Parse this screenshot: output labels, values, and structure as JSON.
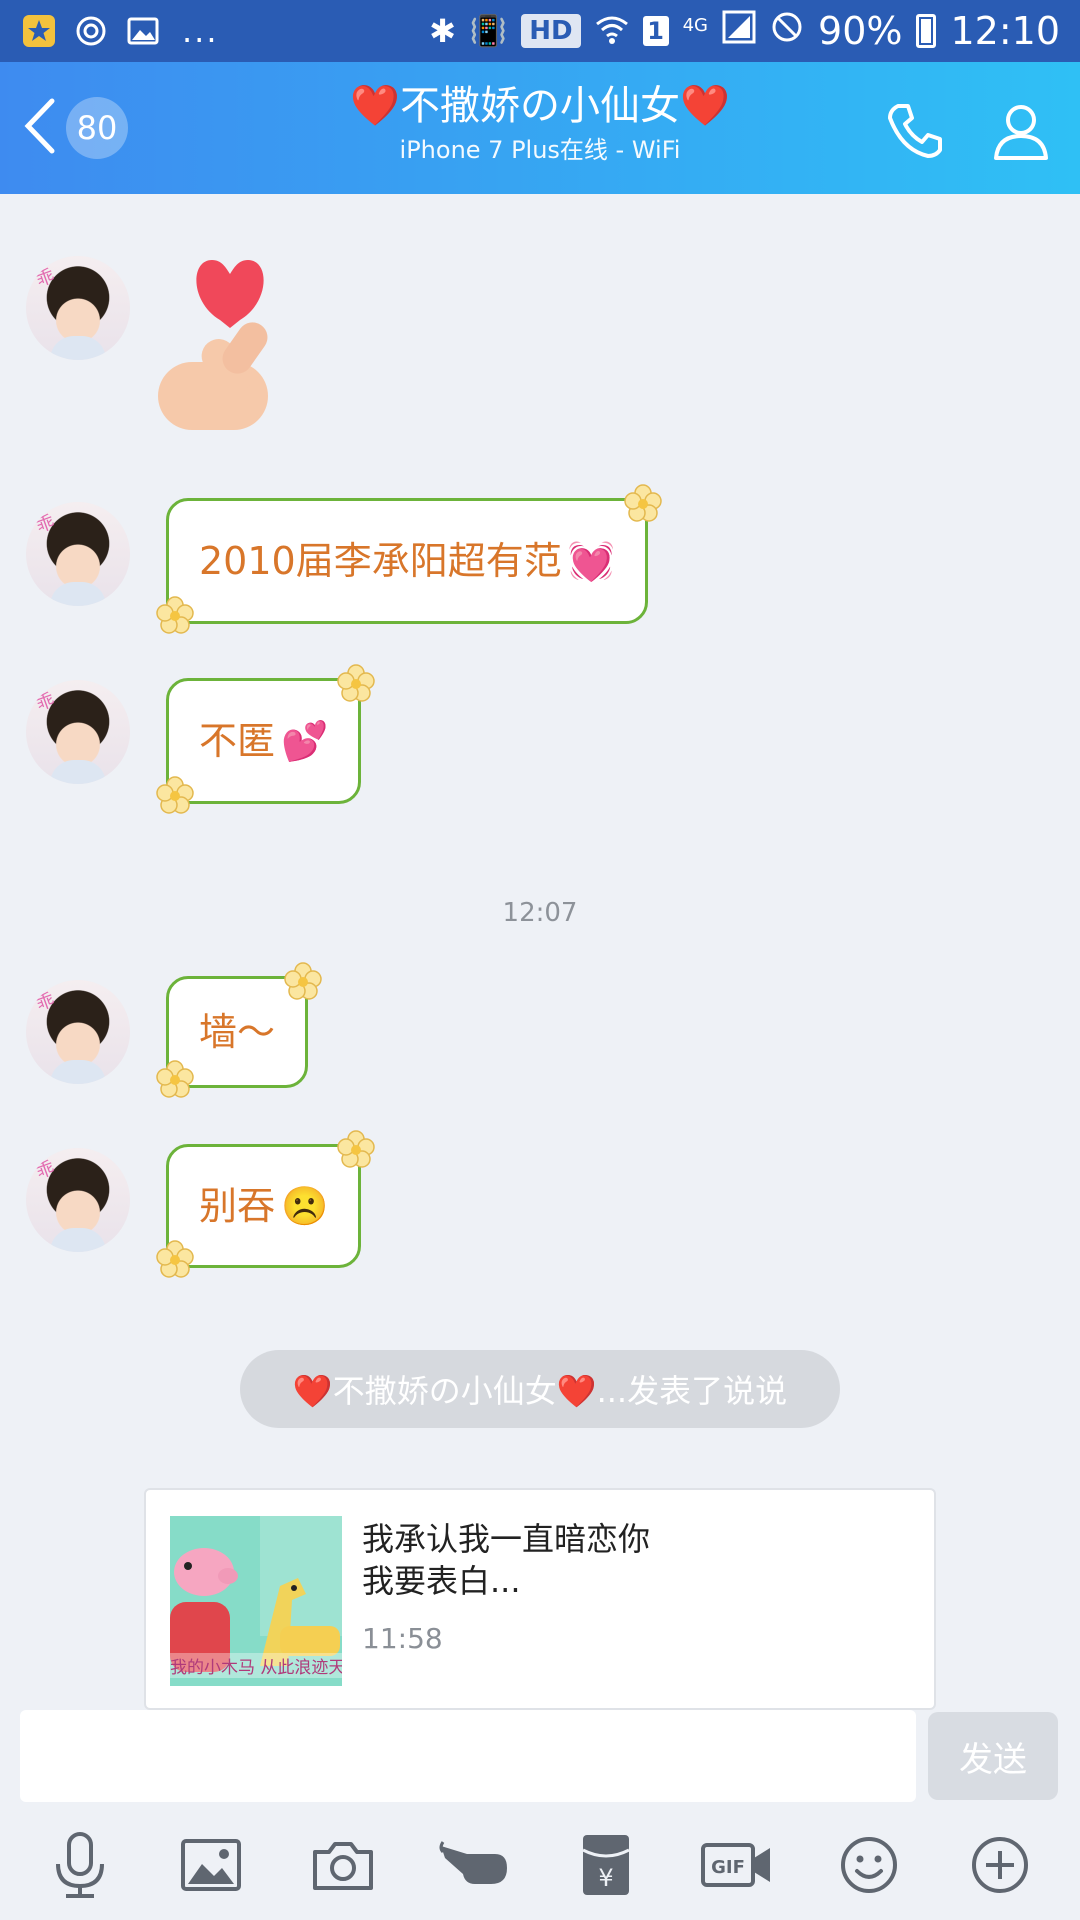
{
  "status_bar": {
    "battery": "90%",
    "time": "12:10",
    "hd": "HD",
    "sim": "1",
    "network": "4G",
    "more": "..."
  },
  "header": {
    "unread_count": "80",
    "contact_name": "❤️不撒娇の小仙女❤️",
    "status": "iPhone 7 Plus在线 - WiFi"
  },
  "chat": {
    "messages": [
      {
        "type": "sticker",
        "emoji": "🫰"
      },
      {
        "type": "text",
        "text": "2010届李承阳超有范",
        "emoji": "💓"
      },
      {
        "type": "text",
        "text": "不匿",
        "emoji": "💕"
      },
      {
        "type": "timestamp",
        "text": "12:07"
      },
      {
        "type": "text",
        "text": "墙～",
        "emoji": ""
      },
      {
        "type": "text",
        "text": "别吞",
        "emoji": "☹️"
      }
    ],
    "system_notice": "❤️不撒娇の小仙女❤️...发表了说说",
    "share": {
      "title": "我承认我一直暗恋你\n我要表白...",
      "time": "11:58",
      "thumb_caption": "我的小木马 从此浪迹天"
    }
  },
  "composer": {
    "placeholder": "",
    "send_label": "发送"
  },
  "toolbar": {
    "items": [
      "microphone",
      "image",
      "camera",
      "poke",
      "red-packet",
      "gif",
      "emoji",
      "more"
    ],
    "gif_label": "GIF",
    "yen_label": "¥"
  },
  "colors": {
    "header_start": "#3e8bf0",
    "header_end": "#2fc0f5",
    "bubble_border": "#6cb33a",
    "bubble_text": "#d8762a"
  }
}
